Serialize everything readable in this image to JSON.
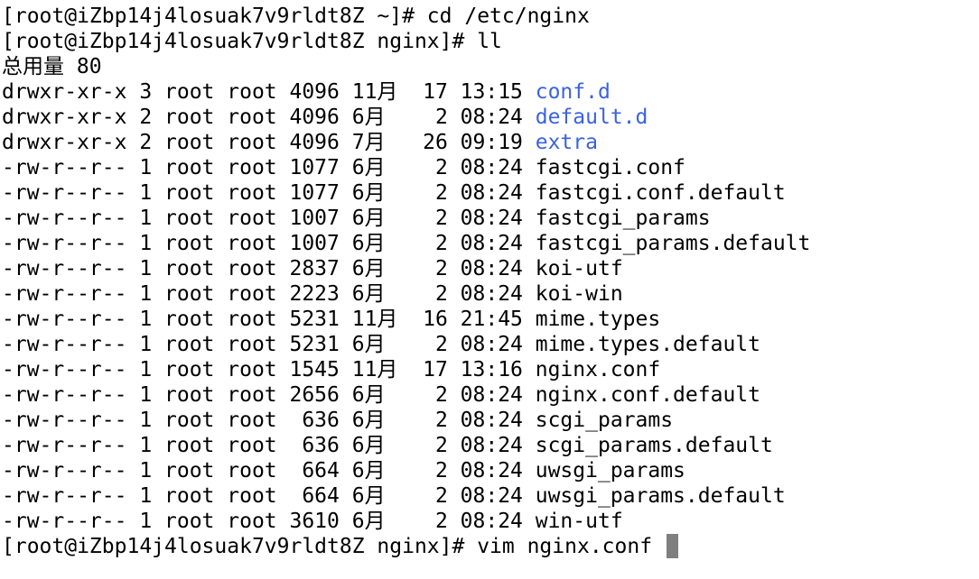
{
  "terminal": {
    "command_lines": [
      "[root@iZbp14j4losuak7v9rldt8Z ~]# cd /etc/nginx",
      "[root@iZbp14j4losuak7v9rldt8Z nginx]# ll"
    ],
    "total_line": "总用量 80",
    "listing": [
      {
        "prefix": "drwxr-xr-x 3 root root 4096 11月  17 13:15 ",
        "name": "conf.d",
        "type": "dir"
      },
      {
        "prefix": "drwxr-xr-x 2 root root 4096 6月    2 08:24 ",
        "name": "default.d",
        "type": "dir"
      },
      {
        "prefix": "drwxr-xr-x 2 root root 4096 7月   26 09:19 ",
        "name": "extra",
        "type": "dir"
      },
      {
        "prefix": "-rw-r--r-- 1 root root 1077 6月    2 08:24 ",
        "name": "fastcgi.conf",
        "type": "file"
      },
      {
        "prefix": "-rw-r--r-- 1 root root 1077 6月    2 08:24 ",
        "name": "fastcgi.conf.default",
        "type": "file"
      },
      {
        "prefix": "-rw-r--r-- 1 root root 1007 6月    2 08:24 ",
        "name": "fastcgi_params",
        "type": "file"
      },
      {
        "prefix": "-rw-r--r-- 1 root root 1007 6月    2 08:24 ",
        "name": "fastcgi_params.default",
        "type": "file"
      },
      {
        "prefix": "-rw-r--r-- 1 root root 2837 6月    2 08:24 ",
        "name": "koi-utf",
        "type": "file"
      },
      {
        "prefix": "-rw-r--r-- 1 root root 2223 6月    2 08:24 ",
        "name": "koi-win",
        "type": "file"
      },
      {
        "prefix": "-rw-r--r-- 1 root root 5231 11月  16 21:45 ",
        "name": "mime.types",
        "type": "file"
      },
      {
        "prefix": "-rw-r--r-- 1 root root 5231 6月    2 08:24 ",
        "name": "mime.types.default",
        "type": "file"
      },
      {
        "prefix": "-rw-r--r-- 1 root root 1545 11月  17 13:16 ",
        "name": "nginx.conf",
        "type": "file"
      },
      {
        "prefix": "-rw-r--r-- 1 root root 2656 6月    2 08:24 ",
        "name": "nginx.conf.default",
        "type": "file"
      },
      {
        "prefix": "-rw-r--r-- 1 root root  636 6月    2 08:24 ",
        "name": "scgi_params",
        "type": "file"
      },
      {
        "prefix": "-rw-r--r-- 1 root root  636 6月    2 08:24 ",
        "name": "scgi_params.default",
        "type": "file"
      },
      {
        "prefix": "-rw-r--r-- 1 root root  664 6月    2 08:24 ",
        "name": "uwsgi_params",
        "type": "file"
      },
      {
        "prefix": "-rw-r--r-- 1 root root  664 6月    2 08:24 ",
        "name": "uwsgi_params.default",
        "type": "file"
      },
      {
        "prefix": "-rw-r--r-- 1 root root 3610 6月    2 08:24 ",
        "name": "win-utf",
        "type": "file"
      }
    ],
    "final_prompt": "[root@iZbp14j4losuak7v9rldt8Z nginx]# vim nginx.conf ",
    "colors": {
      "background": "#ffffff",
      "text": "#000000",
      "directory": "#3b62e0",
      "cursor": "#7f7f7f"
    }
  }
}
